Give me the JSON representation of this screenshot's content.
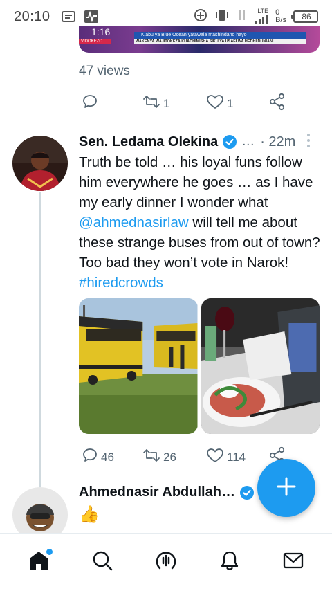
{
  "status_bar": {
    "time": "20:10",
    "network_type": "LTE",
    "speed_value": "0",
    "speed_unit": "B/s",
    "battery": "86"
  },
  "prev_tweet": {
    "media": {
      "clock": "1:16",
      "headline": "Klabu ya Blue Ocean yatawala mashindano hayo",
      "ticker": "WAKENYA WAJITOKEZA KUADHIMISHA SIKU YA USAFI WA HEDHI DUNIANI",
      "tag": "VIDOKEZO"
    },
    "views": "47 views",
    "actions": {
      "reply_count": "",
      "retweet_count": "1",
      "like_count": "1"
    }
  },
  "tweet": {
    "author": "Sen. Ledama Olekina",
    "truncation": "…",
    "time_ago": "· 22m",
    "text_parts": {
      "p1": "Truth be told … his loyal funs follow him everywhere he goes … as I have my early dinner I wonder what ",
      "mention": "@ahmednasirlaw",
      "p2": " will tell me about these strange buses from out of town? Too bad they won’t vote in Narok! ",
      "hashtag": "#hiredcrowds"
    },
    "actions": {
      "reply_count": "46",
      "retweet_count": "26",
      "like_count": "114"
    }
  },
  "reply": {
    "author": "Ahmednasir Abdullah…",
    "text": "👍"
  },
  "colors": {
    "accent": "#1d9bf0",
    "muted": "#536471",
    "thread": "#cfd9de"
  },
  "nav": [
    "home-icon",
    "search-icon",
    "spaces-icon",
    "notifications-icon",
    "messages-icon"
  ]
}
